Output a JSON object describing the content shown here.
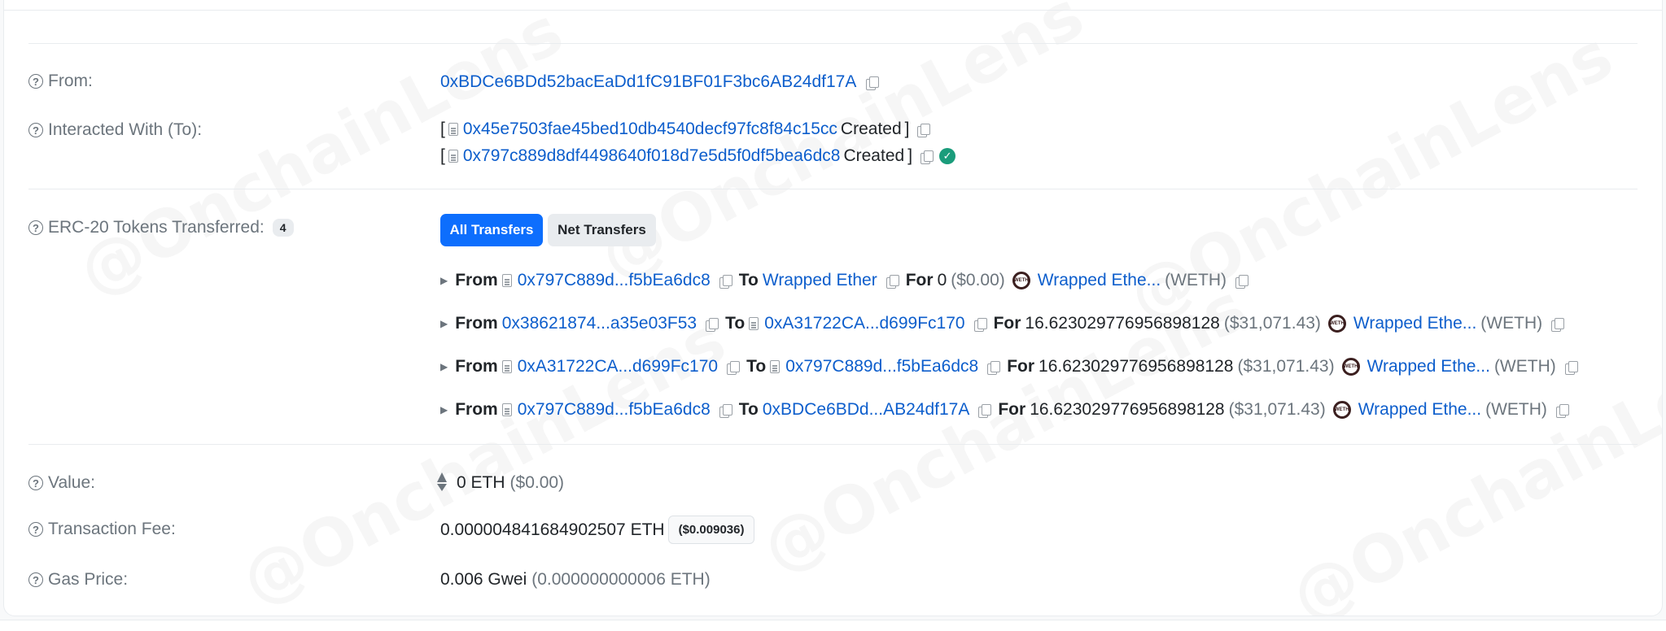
{
  "watermark": "@OnchainLens",
  "from": {
    "label": "From:",
    "address": "0xBDCe6BDd52bacEaDd1fC91BF01F3bc6AB24df17A"
  },
  "interacted_with": {
    "label": "Interacted With (To):",
    "entries": [
      {
        "address": "0x45e7503fae45bed10db4540decf97fc8f84c15cc",
        "status": "Created",
        "verified": false
      },
      {
        "address": "0x797c889d8df4498640f018d7e5d5f0df5bea6dc8",
        "status": "Created",
        "verified": true
      }
    ]
  },
  "erc20": {
    "label": "ERC-20 Tokens Transferred:",
    "count": "4",
    "tabs": {
      "all": "All Transfers",
      "net": "Net Transfers"
    },
    "transfers": [
      {
        "from_kw": "From",
        "from": "0x797C889d...f5bEa6dc8",
        "to_kw": "To",
        "to": "Wrapped Ether",
        "for_kw": "For",
        "amount": "0",
        "usd": "($0.00)",
        "token": "Wrapped Ethe...",
        "symbol": "(WETH)"
      },
      {
        "from_kw": "From",
        "from": "0x38621874...a35e03F53",
        "to_kw": "To",
        "to": "0xA31722CA...d699Fc170",
        "for_kw": "For",
        "amount": "16.623029776956898128",
        "usd": "($31,071.43)",
        "token": "Wrapped Ethe...",
        "symbol": "(WETH)"
      },
      {
        "from_kw": "From",
        "from": "0xA31722CA...d699Fc170",
        "to_kw": "To",
        "to": "0x797C889d...f5bEa6dc8",
        "for_kw": "For",
        "amount": "16.623029776956898128",
        "usd": "($31,071.43)",
        "token": "Wrapped Ethe...",
        "symbol": "(WETH)"
      },
      {
        "from_kw": "From",
        "from": "0x797C889d...f5bEa6dc8",
        "to_kw": "To",
        "to": "0xBDCe6BDd...AB24df17A",
        "for_kw": "For",
        "amount": "16.623029776956898128",
        "usd": "($31,071.43)",
        "token": "Wrapped Ethe...",
        "symbol": "(WETH)"
      }
    ],
    "token_badge": "WETH"
  },
  "value": {
    "label": "Value:",
    "amount": "0 ETH",
    "usd": "($0.00)"
  },
  "fee": {
    "label": "Transaction Fee:",
    "amount": "0.000004841684902507 ETH",
    "usd": "($0.009036)"
  },
  "gas": {
    "label": "Gas Price:",
    "amount": "0.006 Gwei",
    "eth": "(0.000000000006 ETH)"
  },
  "colors": {
    "link": "#0d5ecc",
    "accent": "#0d6efd",
    "verified": "#1a9c7b"
  }
}
